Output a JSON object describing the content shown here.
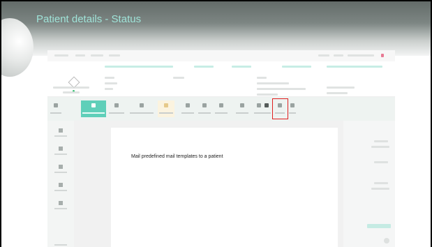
{
  "slide": {
    "title": "Patient details - Status",
    "caption": "Mail predefined mail templates to a patient"
  },
  "colors": {
    "slide_title": "#9fe3d8",
    "accent": "#5fcfb9",
    "highlight": "#e02020"
  },
  "icons": [
    "patient-avatar-icon",
    "mail-icon"
  ]
}
